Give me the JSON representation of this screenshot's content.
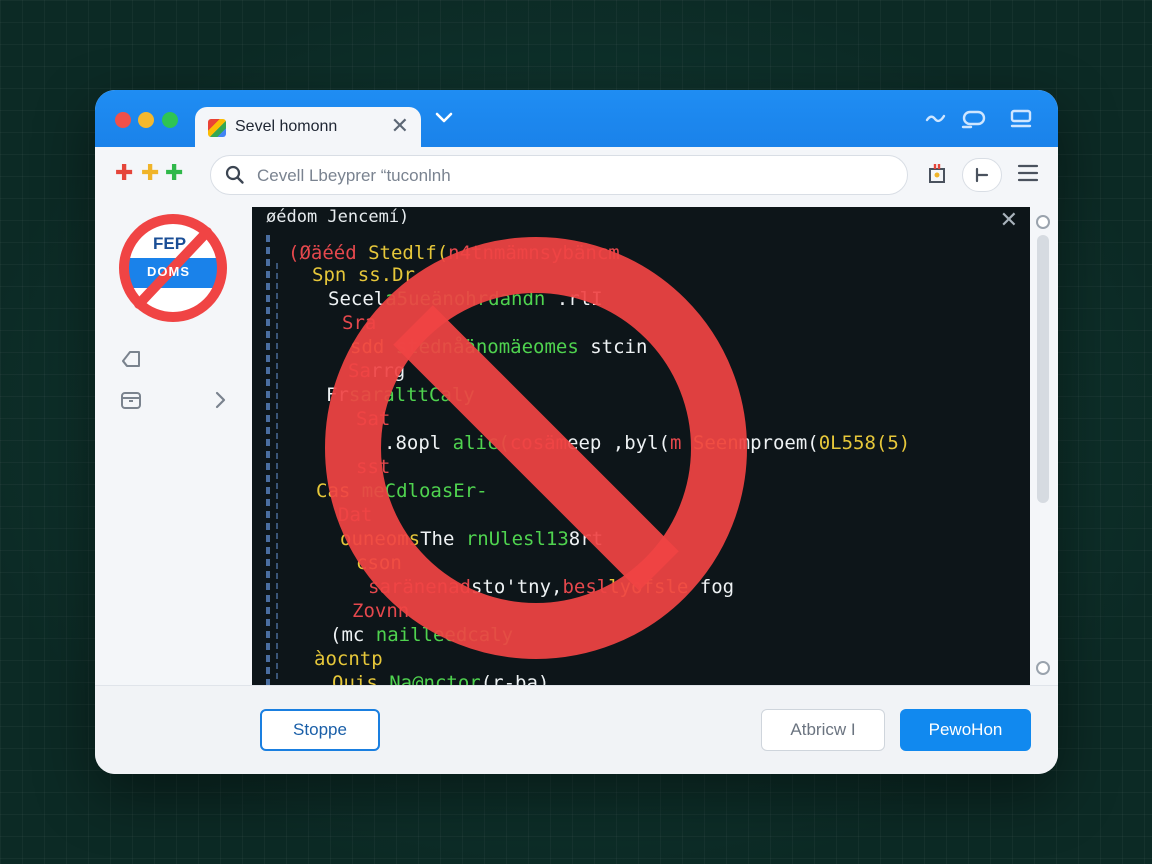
{
  "window": {
    "controls": [
      "close",
      "minimize",
      "maximize"
    ],
    "control_colors": [
      "#f0504a",
      "#f5b82e",
      "#2fc452"
    ]
  },
  "tab": {
    "title": "Sevel homonn",
    "icon": "colorful-app-icon"
  },
  "addressbar": {
    "placeholder": "Cevell Lbeyprer “tuconlnh",
    "search_icon": "search-icon"
  },
  "sidebar": {
    "badge_top": "FEP",
    "badge_bottom": "DOMS",
    "items": [
      {
        "icon": "tag-icon"
      },
      {
        "icon": "folder-icon",
        "expand_icon": "chevron-right-icon"
      }
    ]
  },
  "editor": {
    "title": "øédom Jencemí)",
    "lines": [
      {
        "segments": [
          {
            "text": "(Øäééd ",
            "color": "red"
          },
          {
            "text": "Stedlf(",
            "color": "yel"
          },
          {
            "text": "n4tnmämnsybäncm",
            "color": "red"
          }
        ]
      },
      {
        "segments": [
          {
            "text": "Spn ",
            "color": "yel"
          },
          {
            "text": "ss.Dr",
            "color": "yel"
          }
        ]
      },
      {
        "segments": [
          {
            "text": "Secel",
            "color": "wht"
          },
          {
            "text": "a5ueänohrdandn",
            "color": "grn"
          },
          {
            "text": " .rlI",
            "color": "wht"
          }
        ]
      },
      {
        "segments": [
          {
            "text": "Sra",
            "color": "red"
          }
        ]
      },
      {
        "segments": [
          {
            "text": "sdd ",
            "color": "yel"
          },
          {
            "text": "stednåänomäeomes",
            "color": "grn"
          },
          {
            "text": " stcin",
            "color": "wht"
          }
        ]
      },
      {
        "segments": [
          {
            "text": "Sa",
            "color": "red"
          },
          {
            "text": "rrg",
            "color": "wht"
          }
        ]
      },
      {
        "segments": [
          {
            "text": "Fr",
            "color": "wht"
          },
          {
            "text": "saralttCaly",
            "color": "grn"
          }
        ]
      },
      {
        "segments": [
          {
            "text": "Sat",
            "color": "red"
          }
        ]
      },
      {
        "segments": [
          {
            "text": ".8opl ",
            "color": "wht"
          },
          {
            "text": "alic(",
            "color": "grn"
          },
          {
            "text": "cosäm",
            "color": "red"
          },
          {
            "text": "eep ,byl(",
            "color": "wht"
          },
          {
            "text": "m ",
            "color": "red"
          },
          {
            "text": "Seen",
            "color": "yel"
          },
          {
            "text": "mproem(",
            "color": "wht"
          },
          {
            "text": "0L558(5)",
            "color": "yel"
          }
        ]
      },
      {
        "segments": [
          {
            "text": "sst",
            "color": "red"
          }
        ]
      },
      {
        "segments": [
          {
            "text": "Cas ",
            "color": "yel"
          },
          {
            "text": "meCdloasEr-",
            "color": "grn"
          }
        ]
      },
      {
        "segments": [
          {
            "text": "Dat",
            "color": "red"
          }
        ]
      },
      {
        "segments": [
          {
            "text": "ouneoms",
            "color": "yel"
          },
          {
            "text": "The ",
            "color": "wht"
          },
          {
            "text": "rnUlesl13",
            "color": "grn"
          },
          {
            "text": "8rt",
            "color": "wht"
          }
        ]
      },
      {
        "segments": [
          {
            "text": "cson",
            "color": "yel"
          }
        ]
      },
      {
        "segments": [
          {
            "text": "saränenad",
            "color": "red"
          },
          {
            "text": "sto'tny,",
            "color": "wht"
          },
          {
            "text": "besl",
            "color": "red"
          },
          {
            "text": "lyofsle",
            "color": "yel"
          },
          {
            "text": " fog",
            "color": "wht"
          }
        ]
      },
      {
        "segments": [
          {
            "text": "Zovnn",
            "color": "red"
          }
        ]
      },
      {
        "segments": [
          {
            "text": "(mc ",
            "color": "wht"
          },
          {
            "text": "nailleedcaly",
            "color": "grn"
          }
        ]
      },
      {
        "segments": [
          {
            "text": "àocntp",
            "color": "yel"
          }
        ]
      },
      {
        "segments": [
          {
            "text": "Ouis ",
            "color": "yel"
          },
          {
            "text": "Na@nctor",
            "color": "grn"
          },
          {
            "text": "(r-ba)",
            "color": "wht"
          }
        ]
      }
    ]
  },
  "footer": {
    "stop_label": "Stoppe",
    "cancel_label": "Atbricw I",
    "primary_label": "PewoHon"
  },
  "colors": {
    "accent": "#1189ef",
    "titlebar": "#1f8df3",
    "prohibit_red": "#f04444",
    "editor_bg": "#0d1519"
  }
}
